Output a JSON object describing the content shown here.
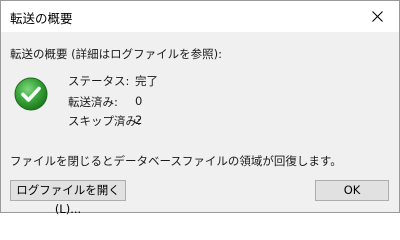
{
  "window": {
    "title": "転送の概要",
    "close_symbol": "×"
  },
  "summary": {
    "heading": "転送の概要 (詳細はログファイルを参照):",
    "status_icon": "check-circle-icon",
    "rows": [
      {
        "label": "ステータス:",
        "value": "完了"
      },
      {
        "label": "転送済み:",
        "value": "0"
      },
      {
        "label": "スキップ済み:",
        "value": "2"
      }
    ]
  },
  "message": "ファイルを閉じるとデータベースファイルの領域が回復します。",
  "buttons": {
    "open_log": "ログファイルを開く(L)...",
    "ok": "OK"
  },
  "colors": {
    "success_green": "#3aa63a",
    "dialog_bg": "#f0f0f0",
    "titlebar_bg": "#ffffff",
    "button_bg": "#e1e1e1",
    "button_border": "#adadad"
  }
}
